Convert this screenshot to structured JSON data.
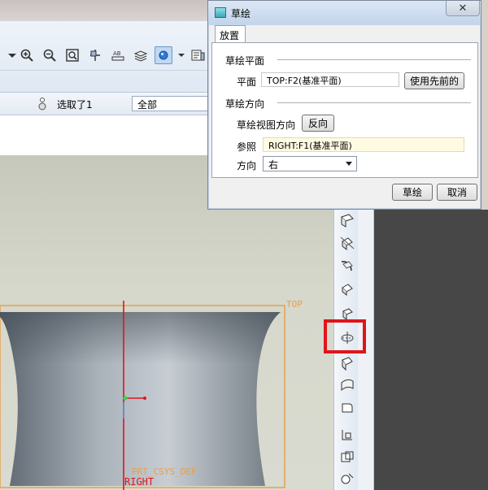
{
  "background_app": {
    "toolbar_icons": [
      "chevron-down-icon",
      "zoom-in-icon",
      "zoom-out-icon",
      "refit-icon",
      "reorient-icon",
      "text-ab-icon",
      "layers-icon",
      "display-style-icon",
      "view-manager-icon"
    ],
    "selection_status": "选取了1",
    "filter_value": "全部",
    "graphics_labels": {
      "top_plane": "TOP",
      "csys": "PRT_CSYS_DEF",
      "right_plane": "RIGHT"
    },
    "right_toolbar_icons": [
      "datum-plane-icon",
      "datum-axis-icon",
      "datum-curve-icon",
      "datum-point-icon",
      "csys-icon",
      "sketch-icon",
      "mirror-icon",
      "surface-icon",
      "blend-icon",
      "boundary-icon",
      "offset-icon",
      "merge-icon"
    ],
    "colors": {
      "model_surface": "#7d8691",
      "datum_plane": "#e6a050",
      "highlight": "#e0141a"
    }
  },
  "dialog": {
    "title": "草绘",
    "close_glyph": "✕",
    "tab_label": "放置",
    "sketch_plane": {
      "section_label": "草绘平面",
      "plane_label": "平面",
      "plane_value": "TOP:F2(基准平面)",
      "use_previous_button": "使用先前的"
    },
    "sketch_orientation": {
      "section_label": "草绘方向",
      "view_direction_label": "草绘视图方向",
      "flip_button": "反向",
      "reference_label": "参照",
      "reference_value": "RIGHT:F1(基准平面)",
      "direction_label": "方向",
      "direction_value": "右"
    },
    "ok_button": "草绘",
    "cancel_button": "取消"
  }
}
